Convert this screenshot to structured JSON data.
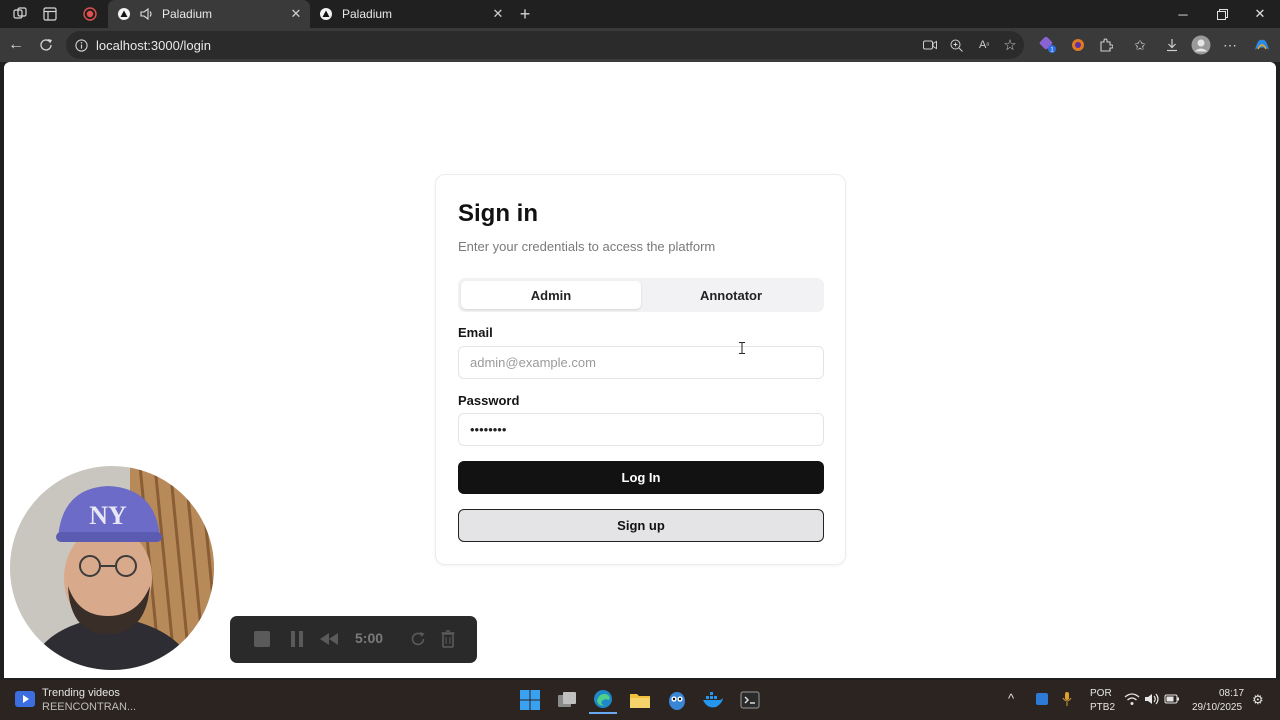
{
  "browser": {
    "tabs": [
      {
        "title": "Paladium",
        "active": true
      },
      {
        "title": "Paladium",
        "active": false
      }
    ],
    "url": "localhost:3000/login"
  },
  "login": {
    "title": "Sign in",
    "subtitle": "Enter your credentials to access the platform",
    "roles": [
      "Admin",
      "Annotator"
    ],
    "selected_role": "Admin",
    "email_label": "Email",
    "email_placeholder": "admin@example.com",
    "email_value": "",
    "password_label": "Password",
    "password_value": "password",
    "login_button": "Log In",
    "signup_button": "Sign up"
  },
  "recorder": {
    "time": "5:00"
  },
  "taskbar": {
    "widget_title": "Trending videos",
    "widget_subtitle": "REENCONTRAN...",
    "language": "POR",
    "layout": "PTB2",
    "time": "08:17",
    "date": "29/10/2025"
  },
  "colors": {
    "accent_dark": "#121212",
    "taskbar": "#2b2420",
    "browser_frame": "#3a3a3a"
  }
}
